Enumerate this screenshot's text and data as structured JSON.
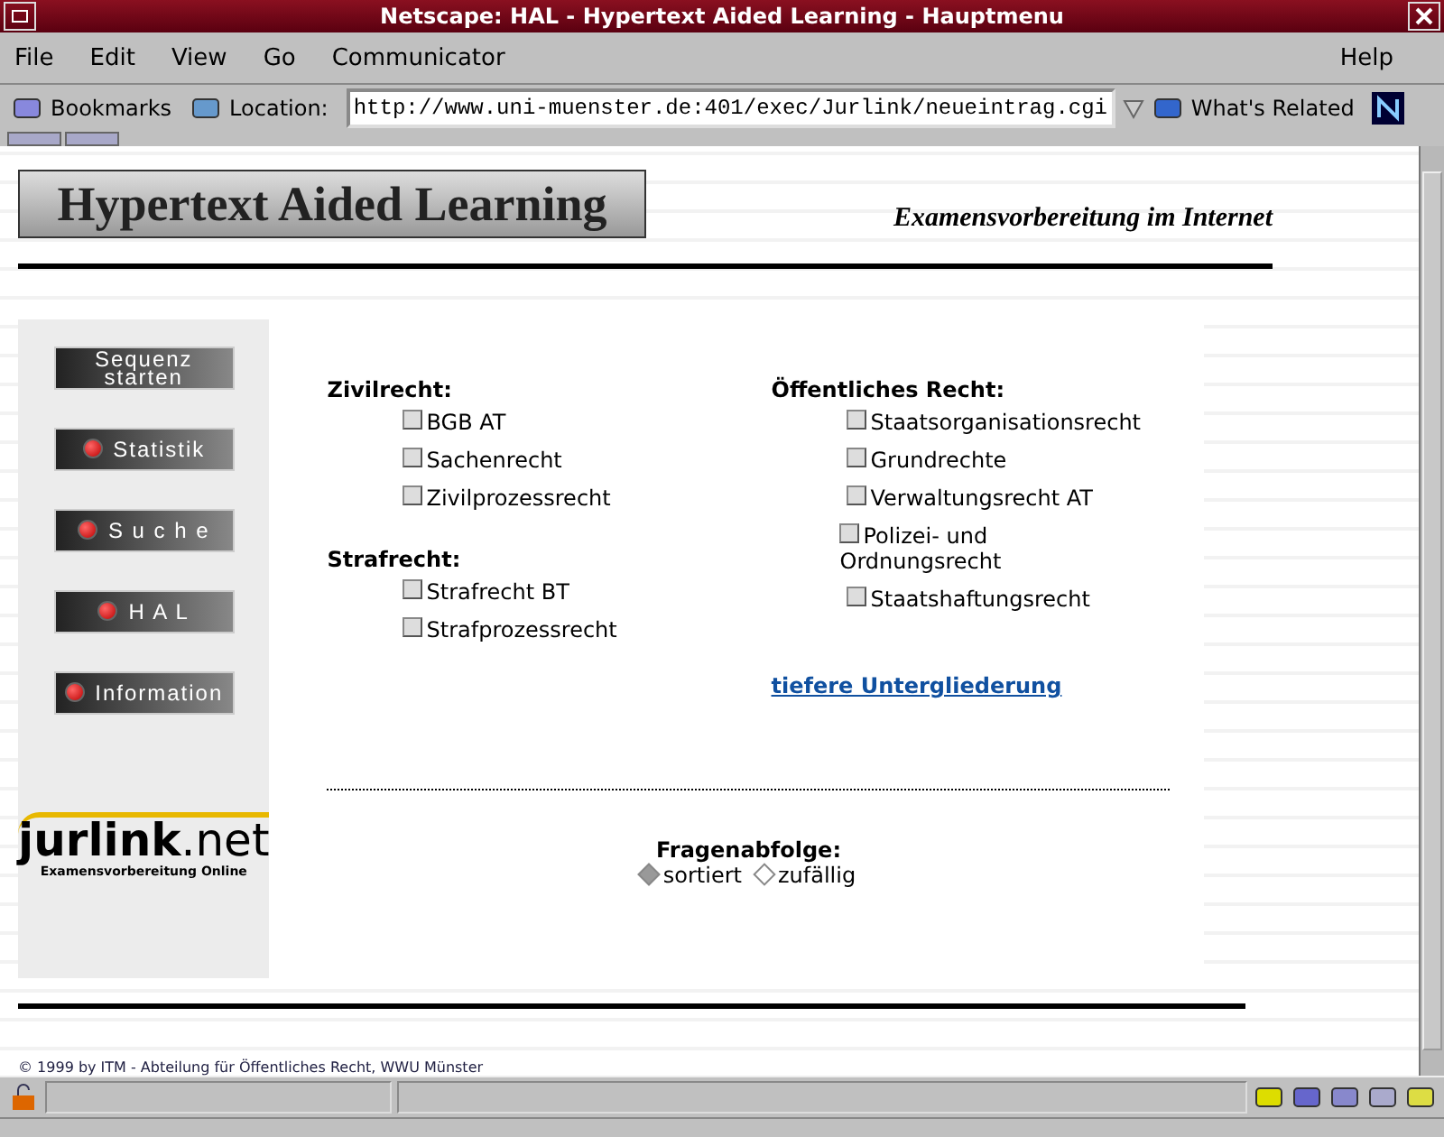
{
  "window": {
    "title": "Netscape: HAL - Hypertext Aided Learning - Hauptmenu"
  },
  "menu": [
    "File",
    "Edit",
    "View",
    "Go",
    "Communicator"
  ],
  "help_menu": "Help",
  "toolbar": {
    "bookmarks": "Bookmarks",
    "location_label": "Location:",
    "location": "http://www.uni-muenster.de:401/exec/Jurlink/neueintrag.cgi",
    "related": "What's Related"
  },
  "banner": {
    "title": "Hypertext Aided Learning",
    "subtitle": "Examensvorbereitung im Internet"
  },
  "nav": [
    {
      "label": "Sequenz starten",
      "kind": "plain"
    },
    {
      "label": "Statistik",
      "kind": "led"
    },
    {
      "label": "S u c h e",
      "kind": "led"
    },
    {
      "label": "H A L",
      "kind": "led"
    },
    {
      "label": "Information",
      "kind": "led"
    }
  ],
  "logo": {
    "name": "jurlink",
    "tld": ".net",
    "tagline": "Examensvorbereitung Online"
  },
  "groups": [
    {
      "title": "Zivilrecht:",
      "items": [
        {
          "label": "BGB AT",
          "checked": false
        },
        {
          "label": "Sachenrecht",
          "checked": false
        },
        {
          "label": "Zivilprozessrecht",
          "checked": false
        }
      ]
    },
    {
      "title": "Strafrecht:",
      "items": [
        {
          "label": "Strafrecht BT",
          "checked": false
        },
        {
          "label": "Strafprozessrecht",
          "checked": false
        }
      ]
    },
    {
      "title": "Öffentliches Recht:",
      "items": [
        {
          "label": "Staatsorganisationsrecht",
          "checked": false
        },
        {
          "label": "Grundrechte",
          "checked": false
        },
        {
          "label": "Verwaltungsrecht AT",
          "checked": false
        },
        {
          "label": "Polizei- und Ordnungsrecht",
          "checked": false
        },
        {
          "label": "Staatshaftungsrecht",
          "checked": false
        }
      ]
    }
  ],
  "link": "tiefere Untergliederung",
  "order": {
    "title": "Fragenabfolge:",
    "options": [
      {
        "label": "sortiert",
        "selected": true
      },
      {
        "label": "zufällig",
        "selected": false
      }
    ]
  },
  "footer": "© 1999 by ITM - Abteilung für Öffentliches Recht, WWU Münster"
}
